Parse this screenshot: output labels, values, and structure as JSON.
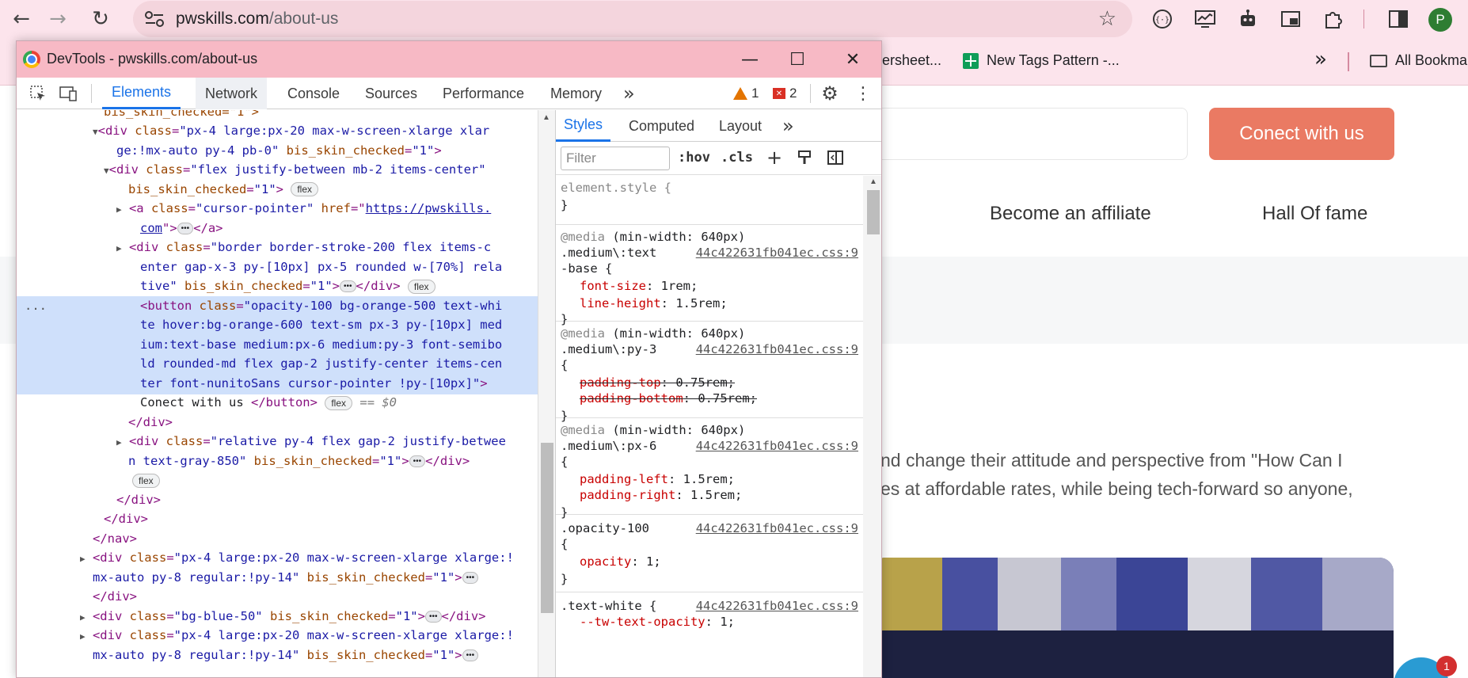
{
  "browser": {
    "url_host": "pwskills.com",
    "url_path": "/about-us",
    "profile_initial": "P",
    "bookmarks": [
      {
        "label": "ersheet..."
      },
      {
        "label": "New Tags Pattern -..."
      },
      {
        "label": "All Bookma"
      }
    ],
    "more_bookmarks": "»"
  },
  "website": {
    "cta_label": "Conect with us",
    "nav_links": [
      "Become an affiliate",
      "Hall Of fame"
    ],
    "para_line1": "nd change their attitude and perspective from \"How Can I",
    "para_line2": "es at affordable rates, while being tech-forward so anyone,",
    "chat_badge": "1"
  },
  "devtools": {
    "window_title": "DevTools - pwskills.com/about-us",
    "tabs": [
      "Elements",
      "Network",
      "Console",
      "Sources",
      "Performance",
      "Memory"
    ],
    "more_tabs": "»",
    "warning_count": "1",
    "error_count": "2",
    "styles_tabs": [
      "Styles",
      "Computed",
      "Layout"
    ],
    "filter_placeholder": "Filter",
    "hov_label": ":hov",
    "cls_label": ".cls",
    "tree": {
      "l0": "bis_skin_checked=\"1\">",
      "l1": {
        "tag": "<div ",
        "attr": "class",
        "val": "\"px-4 large:px-20 max-w-screen-xlarge xlar"
      },
      "l2": {
        "val": "ge:!mx-auto py-4 pb-0\"",
        "attr": "bis_skin_checked",
        "val2": "\"1\"",
        "close": ">"
      },
      "l3": {
        "tag": "<div ",
        "attr": "class",
        "val": "\"flex justify-between mb-2 items-center\""
      },
      "l4": {
        "attr": "bis_skin_checked",
        "val": "\"1\"",
        "close": ">",
        "badge": "flex"
      },
      "l5": {
        "tag": "<a ",
        "attr": "class",
        "val": "\"cursor-pointer\"",
        "attr2": "href",
        "link": "https://pwskills."
      },
      "l6": {
        "link": "com",
        "close": "\">",
        "dots": "•••",
        "end": "</a>"
      },
      "l7": {
        "tag": "<div ",
        "attr": "class",
        "val": "\"border border-stroke-200 flex items-c"
      },
      "l8": {
        "val": "enter gap-x-3 py-[10px] px-5 rounded w-[70%] rela"
      },
      "l9": {
        "val": "tive\"",
        "attr": "bis_skin_checked",
        "val2": "\"1\"",
        "close": ">",
        "dots": "•••",
        "end": "</div>",
        "badge": "flex"
      },
      "l10": {
        "tag": "<button ",
        "attr": "class",
        "val": "\"opacity-100 bg-orange-500 text-whi"
      },
      "l11": {
        "val": "te hover:bg-orange-600 text-sm px-3 py-[10px] med"
      },
      "l12": {
        "val": "ium:text-base medium:px-6 medium:py-3 font-semibo"
      },
      "l13": {
        "val": "ld rounded-md flex gap-2 justify-center items-cen"
      },
      "l14": {
        "val": "ter font-nunitoSans cursor-pointer !py-[10px]\"",
        "close": ">"
      },
      "l15": {
        "text": "Conect with us ",
        "end": "</button>",
        "badge": "flex",
        "dollar": "== $0"
      },
      "l16": {
        "end": "</div>"
      },
      "l17": {
        "tag": "<div ",
        "attr": "class",
        "val": "\"relative py-4 flex gap-2 justify-betwee"
      },
      "l18": {
        "val": "n text-gray-850\"",
        "attr": "bis_skin_checked",
        "val2": "\"1\"",
        "close": ">",
        "dots": "•••",
        "end": "</div>"
      },
      "l19": {
        "badge": "flex"
      },
      "l20": {
        "end": "</div>"
      },
      "l21": {
        "end": "</div>"
      },
      "l22": {
        "end": "</nav>"
      },
      "l23": {
        "tag": "<div ",
        "attr": "class",
        "val": "\"px-4 large:px-20 max-w-screen-xlarge xlarge:!"
      },
      "l24": {
        "val": "mx-auto py-8 regular:!py-14\"",
        "attr": "bis_skin_checked",
        "val2": "\"1\"",
        "close": ">",
        "dots": "•••"
      },
      "l25": {
        "end": "</div>"
      },
      "l26": {
        "tag": "<div ",
        "attr": "class",
        "val": "\"bg-blue-50\"",
        "attr2": "bis_skin_checked",
        "val2": "\"1\"",
        "close": ">",
        "dots": "•••",
        "end": "</div>"
      },
      "l27": {
        "tag": "<div ",
        "attr": "class",
        "val": "\"px-4 large:px-20 max-w-screen-xlarge xlarge:!"
      },
      "l28": {
        "val": "mx-auto py-8 regular:!py-14\"",
        "attr": "bis_skin_checked",
        "val2": "\"1\"",
        "close": ">",
        "dots": "•••"
      },
      "ellipsis": "..."
    },
    "styles": {
      "r0": {
        "sel": "element.style {",
        "close": "}"
      },
      "r1": {
        "media": "@media",
        "cond": " (min-width: 640px)",
        "sel1": ".medium\\:text",
        "sel2": "-base {",
        "src": "44c422631fb041ec.css:9",
        "p1": "font-size",
        "v1": " 1rem;",
        "p2": "line-height",
        "v2": " 1.5rem;",
        "close": "}"
      },
      "r2": {
        "media": "@media",
        "cond": " (min-width: 640px)",
        "sel1": ".medium\\:py-3",
        "sel2": "{",
        "src": "44c422631fb041ec.css:9",
        "p1": "padding-top",
        "v1": " 0.75rem;",
        "p2": "padding-bottom",
        "v2": " 0.75rem;",
        "close": "}"
      },
      "r3": {
        "media": "@media",
        "cond": " (min-width: 640px)",
        "sel1": ".medium\\:px-6",
        "sel2": "{",
        "src": "44c422631fb041ec.css:9",
        "p1": "padding-left",
        "v1": " 1.5rem;",
        "p2": "padding-right",
        "v2": " 1.5rem;",
        "close": "}"
      },
      "r4": {
        "sel1": ".opacity-100",
        "sel2": "{",
        "src": "44c422631fb041ec.css:9",
        "p1": "opacity",
        "v1": " 1;",
        "close": "}"
      },
      "r5": {
        "sel1": ".text-white {",
        "src": "44c422631fb041ec.css:9",
        "p1": "--tw-text-opacity",
        "v1": " 1;"
      }
    }
  }
}
